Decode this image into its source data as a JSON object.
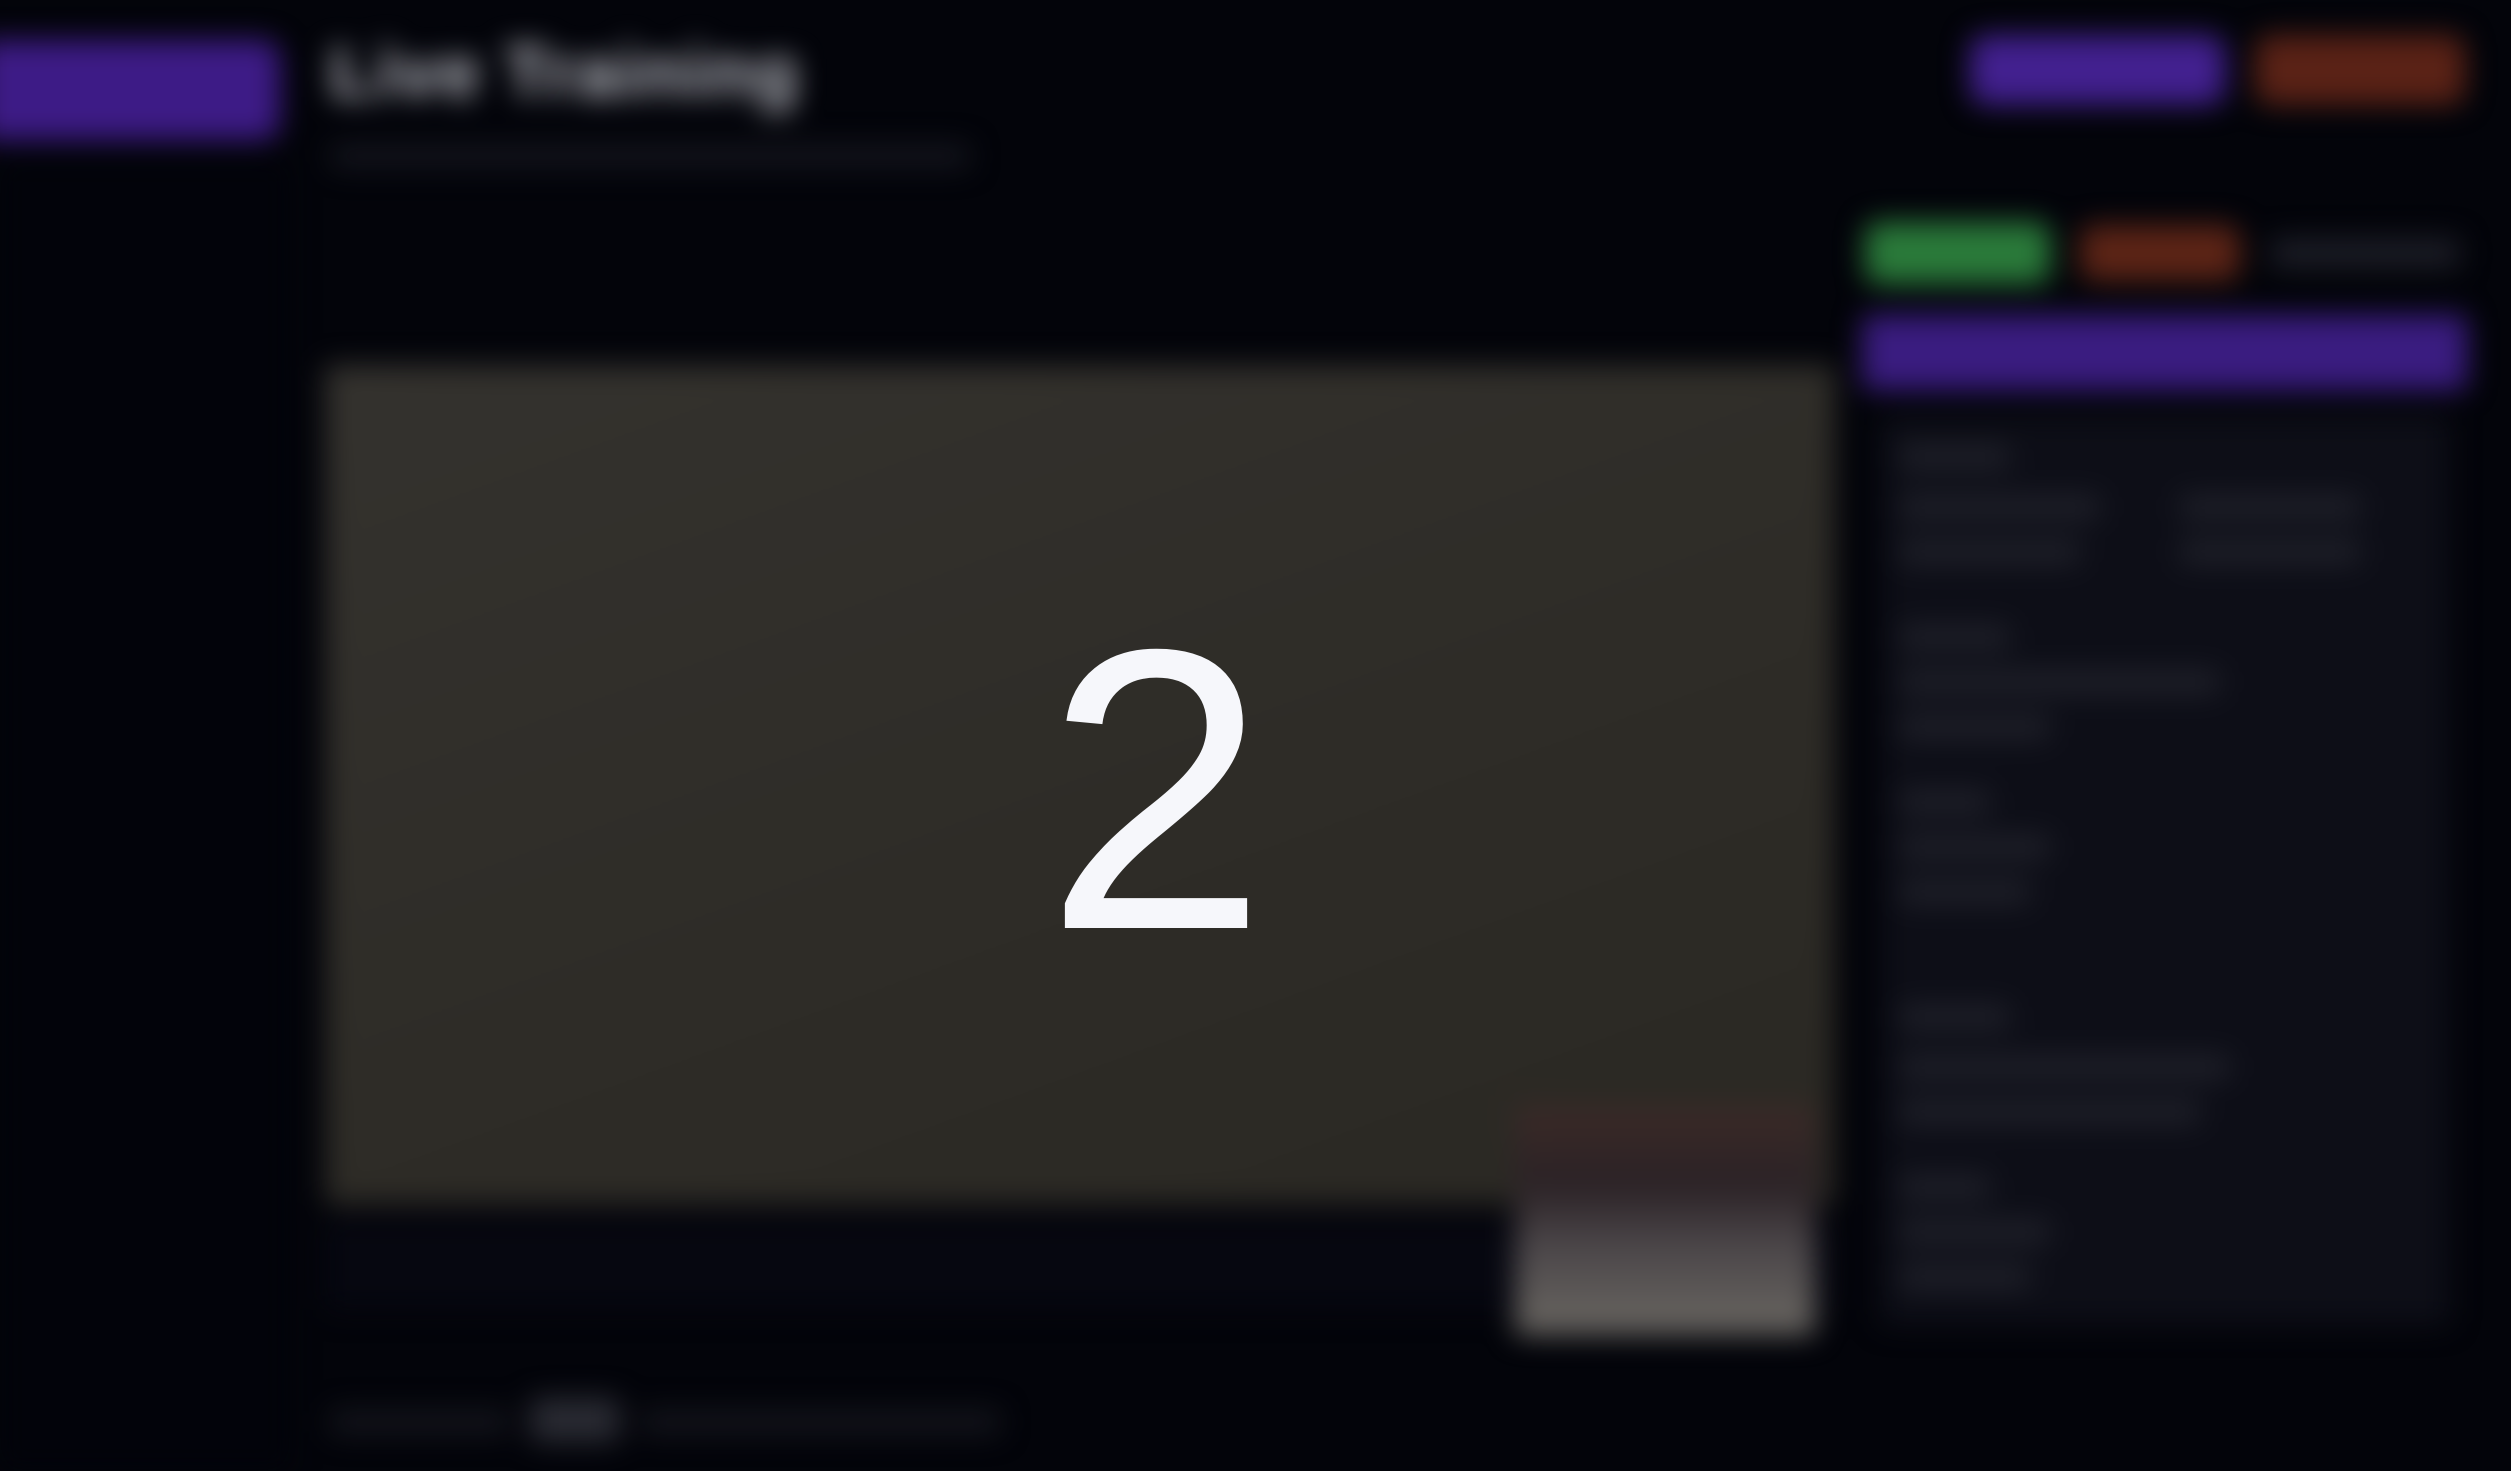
{
  "header": {
    "title": "Live Training",
    "brand_button_label": "",
    "subtitle": ""
  },
  "top_actions": [
    {
      "label": "",
      "color": "#42208f"
    },
    {
      "label": "",
      "color": "#5a2216"
    }
  ],
  "status_badges": [
    {
      "label": "",
      "color": "#2a7a3a"
    },
    {
      "label": "",
      "color": "#5c2416"
    }
  ],
  "countdown": {
    "value": "2"
  },
  "colors": {
    "background": "#03040a",
    "accent": "#3a1c80",
    "countdown_text": "#f6f7fb"
  }
}
